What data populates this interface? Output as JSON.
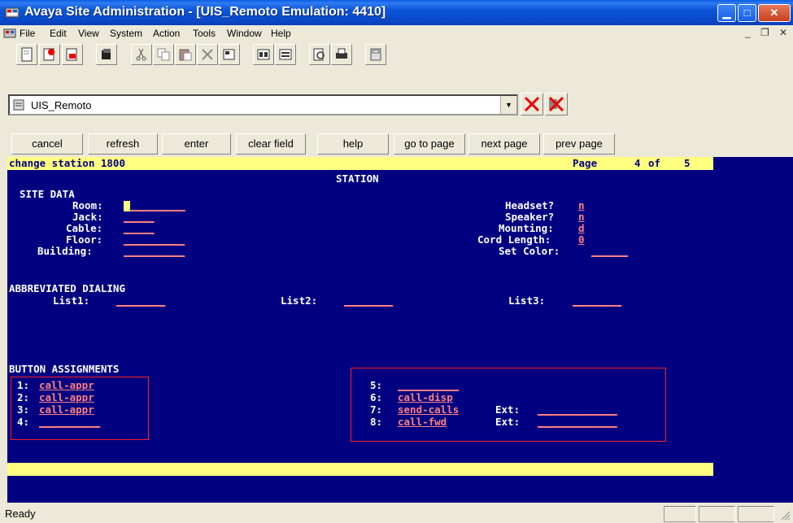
{
  "window": {
    "title": "Avaya Site Administration - [UIS_Remoto Emulation: 4410]"
  },
  "menu": [
    "File",
    "Edit",
    "View",
    "System",
    "Action",
    "Tools",
    "Window",
    "Help"
  ],
  "toolbar_icons": [
    "new-icon",
    "open-icon",
    "save-icon",
    "print-setup-icon",
    "cut-icon",
    "copy-icon",
    "paste-icon",
    "delete-icon",
    "properties-icon",
    "view1-icon",
    "view2-icon",
    "print-preview-icon",
    "print-icon",
    "calculator-icon"
  ],
  "site": {
    "selected": "UIS_Remoto"
  },
  "function_keys": [
    "cancel",
    "refresh",
    "enter",
    "clear field",
    "help",
    "go to page",
    "next page",
    "prev page"
  ],
  "screen": {
    "command": "change station 1800",
    "page_label": "Page",
    "page_current": "4",
    "page_of": "of",
    "page_total": "5",
    "heading": "STATION",
    "site_data": {
      "title": "SITE DATA",
      "room_label": "Room:",
      "room_value": "_________",
      "jack_label": "Jack:",
      "jack_value": "_____",
      "cable_label": "Cable:",
      "cable_value": "_____",
      "floor_label": "Floor:",
      "floor_value": "__________",
      "building_label": "Building:",
      "building_value": "__________",
      "headset_label": "Headset?",
      "headset_value": "n",
      "speaker_label": "Speaker?",
      "speaker_value": "n",
      "mounting_label": "Mounting:",
      "mounting_value": "d",
      "cord_label": "Cord Length:",
      "cord_value": "0",
      "color_label": "Set Color:",
      "color_value": "______"
    },
    "abbrev": {
      "title": "ABBREVIATED DIALING",
      "list1_label": "List1:",
      "list1_value": "________",
      "list2_label": "List2:",
      "list2_value": "________",
      "list3_label": "List3:",
      "list3_value": "________"
    },
    "buttons": {
      "title": "BUTTON ASSIGNMENTS",
      "b1_label": "1:",
      "b1_value": "call-appr",
      "b2_label": "2:",
      "b2_value": "call-appr",
      "b3_label": "3:",
      "b3_value": "call-appr",
      "b4_label": "4:",
      "b4_value": "__________",
      "b5_label": "5:",
      "b5_value": "__________",
      "b6_label": "6:",
      "b6_value": "call-disp",
      "b7_label": "7:",
      "b7_value": "send-calls",
      "b7_ext_label": "Ext:",
      "b7_ext_value": "_____________",
      "b8_label": "8:",
      "b8_value": "call-fwd",
      "b8_ext_label": "Ext:",
      "b8_ext_value": "_____________"
    }
  },
  "status": {
    "text": "Ready"
  },
  "colors": {
    "terminal_bg": "#000080",
    "highlight_bar": "#ffff80",
    "field_value": "#ff8080",
    "box_outline": "#ff2020"
  }
}
